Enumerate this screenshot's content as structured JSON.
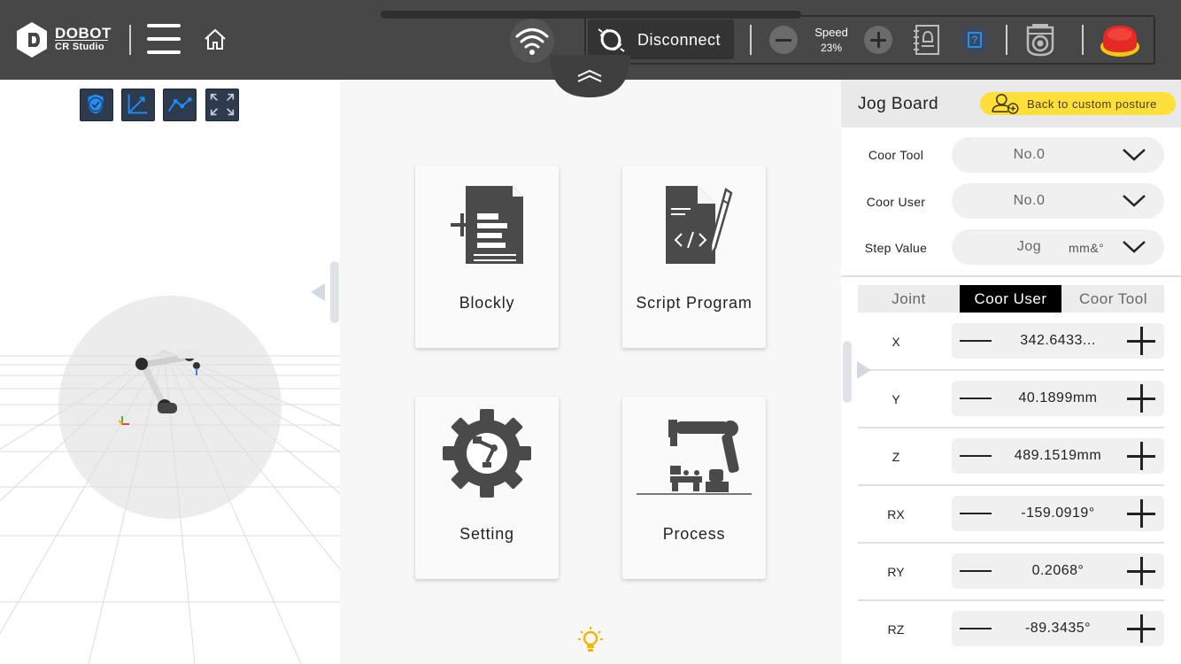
{
  "brand": {
    "name": "DOBOT",
    "product": "CR Studio"
  },
  "header": {
    "disconnect_label": "Disconnect",
    "speed_label": "Speed",
    "speed_value": "23%"
  },
  "colors": {
    "topbar": "#474747",
    "accent_blue": "#1e8fff",
    "back_button": "#ffe03a",
    "estop_red": "#e42a25",
    "estop_yellow": "#f6c710",
    "active_tab": "#000000"
  },
  "icons": {
    "menu": "hamburger-menu-icon",
    "home": "home-icon",
    "wifi": "wifi-icon",
    "disconnect": "disconnect-link-icon",
    "log": "log-notebook-icon",
    "help": "help-icon",
    "camera": "camera-icon",
    "estop": "emergency-stop-icon"
  },
  "cards": [
    {
      "label": "Blockly",
      "icon": "blockly-document-icon"
    },
    {
      "label": "Script Program",
      "icon": "script-program-icon"
    },
    {
      "label": "Setting",
      "icon": "setting-gear-icon"
    },
    {
      "label": "Process",
      "icon": "process-robot-icon"
    }
  ],
  "jog": {
    "title": "Jog Board",
    "back_label": "Back to custom posture",
    "fields": [
      {
        "label": "Coor Tool",
        "value": "No.0",
        "unit": ""
      },
      {
        "label": "Coor User",
        "value": "No.0",
        "unit": ""
      },
      {
        "label": "Step Value",
        "value": "Jog",
        "unit": "mm&°"
      }
    ],
    "tabs": [
      "Joint",
      "Coor User",
      "Coor Tool"
    ],
    "active_tab": "Coor User",
    "axes": [
      {
        "label": "X",
        "value": "342.6433..."
      },
      {
        "label": "Y",
        "value": "40.1899mm"
      },
      {
        "label": "Z",
        "value": "489.1519mm"
      },
      {
        "label": "RX",
        "value": "-159.0919°"
      },
      {
        "label": "RY",
        "value": "0.2068°"
      },
      {
        "label": "RZ",
        "value": "-89.3435°"
      }
    ]
  }
}
